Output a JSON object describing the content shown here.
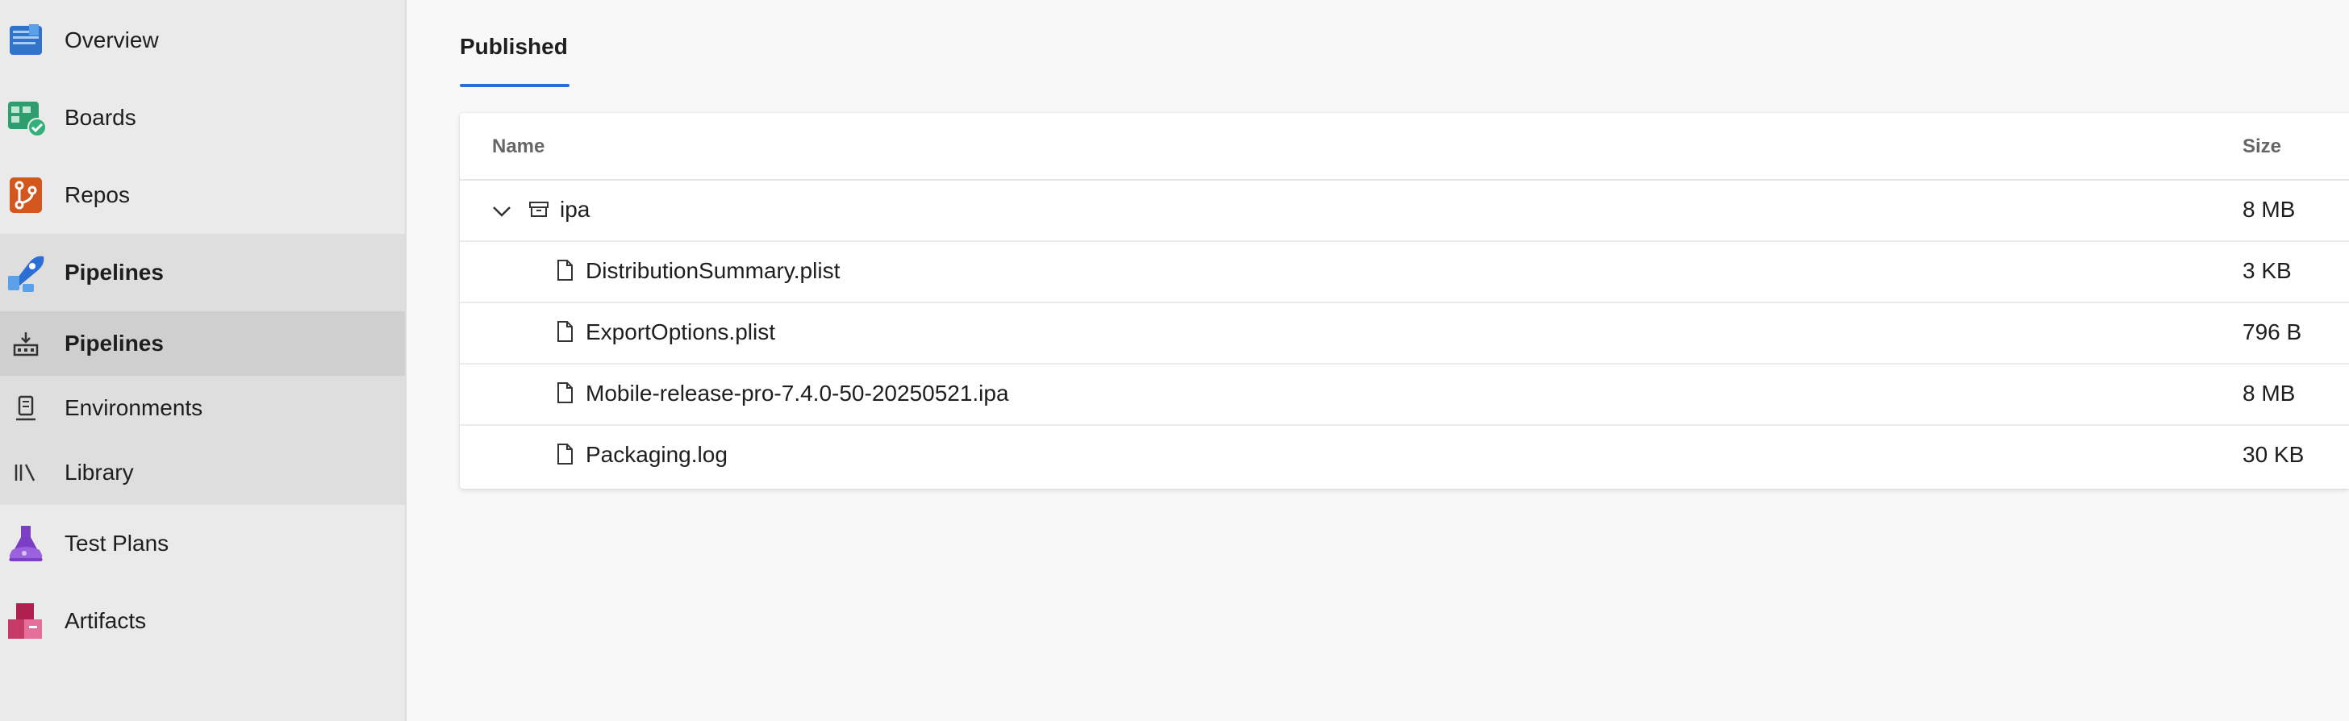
{
  "sidebar": {
    "items": [
      {
        "label": "Overview",
        "icon": "overview-icon"
      },
      {
        "label": "Boards",
        "icon": "boards-icon"
      },
      {
        "label": "Repos",
        "icon": "repos-icon"
      },
      {
        "label": "Pipelines",
        "icon": "pipelines-icon"
      },
      {
        "label": "Pipelines",
        "icon": "pipelines-sub-icon"
      },
      {
        "label": "Environments",
        "icon": "environments-icon"
      },
      {
        "label": "Library",
        "icon": "library-icon"
      },
      {
        "label": "Test Plans",
        "icon": "test-plans-icon"
      },
      {
        "label": "Artifacts",
        "icon": "artifacts-icon"
      }
    ]
  },
  "main": {
    "tab": "Published",
    "table": {
      "col_name": "Name",
      "col_size": "Size",
      "rows": [
        {
          "name": "ipa",
          "size": "8 MB",
          "type": "folder"
        },
        {
          "name": "DistributionSummary.plist",
          "size": "3 KB",
          "type": "file"
        },
        {
          "name": "ExportOptions.plist",
          "size": "796 B",
          "type": "file"
        },
        {
          "name": "Mobile-release-pro-7.4.0-50-20250521.ipa",
          "size": "8 MB",
          "type": "file"
        },
        {
          "name": "Packaging.log",
          "size": "30 KB",
          "type": "file"
        }
      ]
    }
  },
  "colors": {
    "accent": "#2b6fd4",
    "sidebar_bg": "#eaeaea",
    "selected_bg": "#cfcfcf"
  }
}
